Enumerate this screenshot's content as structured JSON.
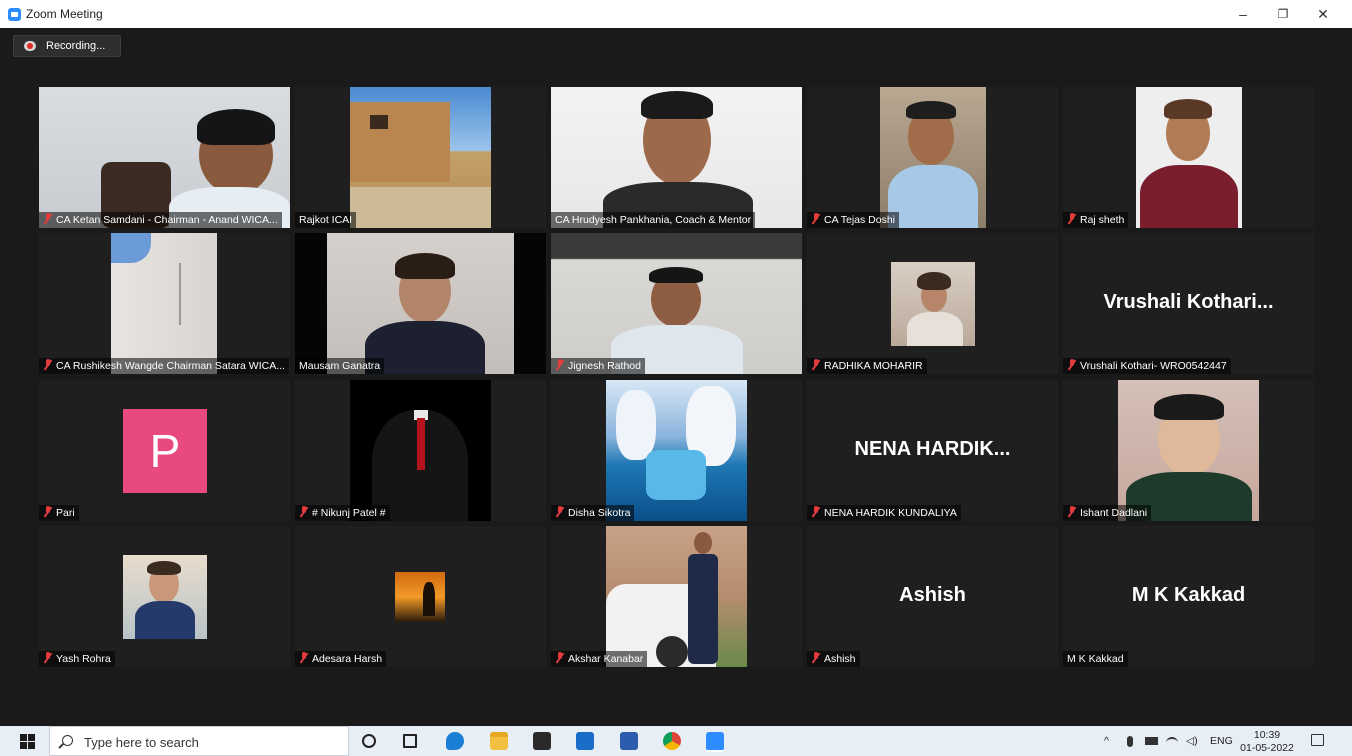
{
  "window": {
    "title": "Zoom Meeting",
    "minimize": "–",
    "restore": "❐",
    "close": "✕"
  },
  "recording": {
    "label": "Recording..."
  },
  "participants": [
    {
      "name": "CA Ketan Samdani - Chairman - Anand WICA...",
      "muted": true
    },
    {
      "name": "Rajkot ICAI",
      "muted": false
    },
    {
      "name": "CA Hrudyesh Pankhania, Coach & Mentor",
      "muted": false
    },
    {
      "name": "CA Tejas Doshi",
      "muted": true
    },
    {
      "name": "Raj sheth",
      "muted": true
    },
    {
      "name": "CA Rushikesh Wangde Chairman Satara WICA...",
      "muted": true
    },
    {
      "name": "Mausam Ganatra",
      "muted": false,
      "active_speaker": true
    },
    {
      "name": "Jignesh Rathod",
      "muted": true
    },
    {
      "name": "RADHIKA MOHARIR",
      "muted": true
    },
    {
      "name": "Vrushali Kothari- WRO0542447",
      "muted": true,
      "display_text": "Vrushali  Kothari..."
    },
    {
      "name": "Pari",
      "muted": true,
      "avatar_letter": "P"
    },
    {
      "name": "# Nikunj Patel #",
      "muted": true
    },
    {
      "name": "Disha Sikotra",
      "muted": true
    },
    {
      "name": "NENA  HARDIK KUNDALIYA",
      "muted": true,
      "display_text": "NENA  HARDIK..."
    },
    {
      "name": "Ishant Dadlani",
      "muted": true
    },
    {
      "name": "Yash Rohra",
      "muted": true
    },
    {
      "name": "Adesara Harsh",
      "muted": true
    },
    {
      "name": "Akshar Kanabar",
      "muted": true
    },
    {
      "name": "Ashish",
      "muted": true,
      "display_text": "Ashish"
    },
    {
      "name": "M K Kakkad",
      "muted": false,
      "display_text": "M K Kakkad"
    }
  ],
  "taskbar": {
    "search_placeholder": "Type here to search",
    "tray": {
      "lang": "ENG",
      "time": "10:39",
      "date": "01-05-2022"
    },
    "pinned_icons": [
      "cortana-icon",
      "task-view-icon",
      "edge-icon",
      "file-explorer-icon",
      "store-icon",
      "mail-icon",
      "word-icon",
      "chrome-icon",
      "zoom-icon"
    ]
  },
  "colors": {
    "active_speaker_border": "#c9e265",
    "mute_red": "#e53b3b",
    "avatar_pink": "#e84a7f",
    "zoom_blue": "#2d8cff"
  }
}
